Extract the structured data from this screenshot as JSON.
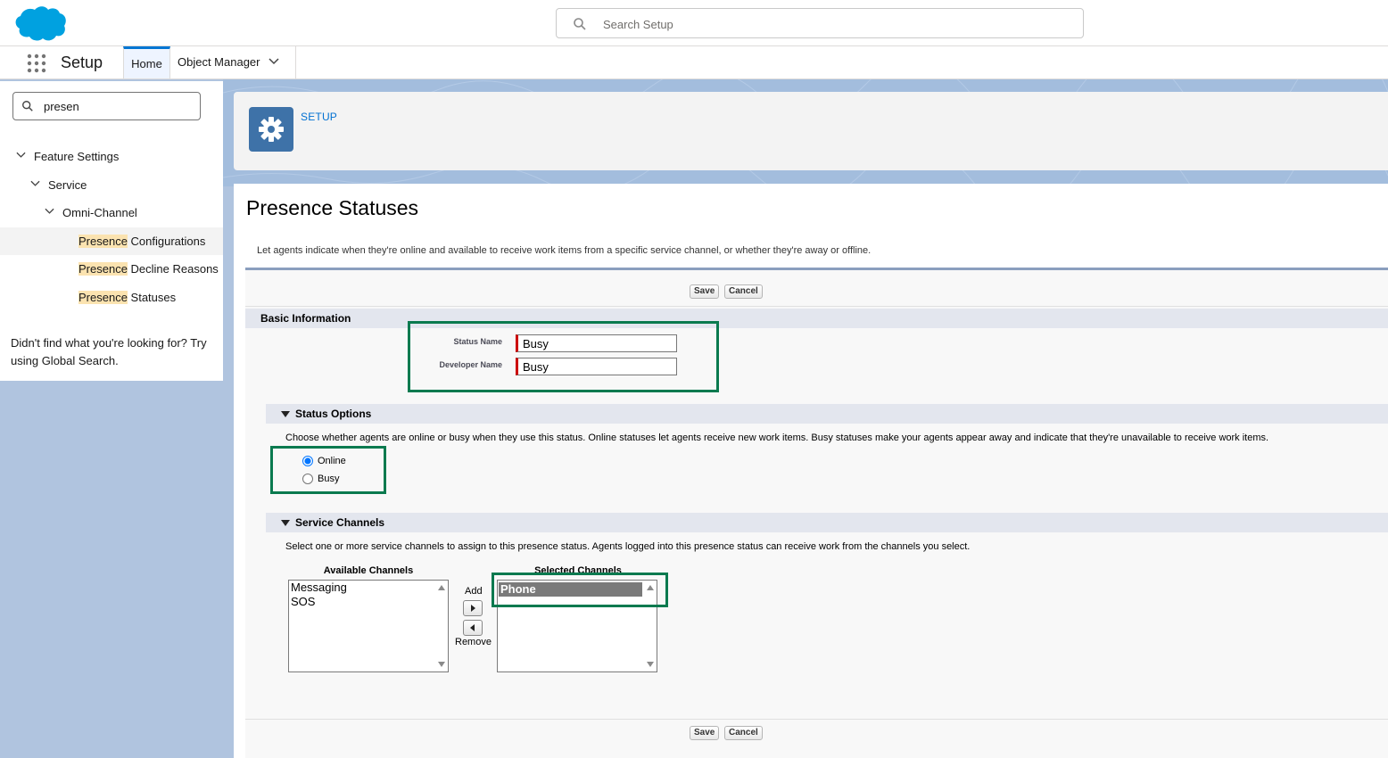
{
  "header": {
    "search_placeholder": "Search Setup",
    "brand_color": "#00a1e0"
  },
  "nav": {
    "app_name": "Setup",
    "tabs": [
      {
        "label": "Home",
        "active": true
      },
      {
        "label": "Object Manager",
        "has_dropdown": true
      }
    ]
  },
  "sidebar": {
    "quickfind_value": "presen",
    "tree": {
      "feature_settings": "Feature Settings",
      "service": "Service",
      "omni_channel": "Omni-Channel",
      "leaves": [
        {
          "match": "Presence",
          "rest": " Configurations",
          "selected": true
        },
        {
          "match": "Presence",
          "rest": " Decline Reasons",
          "selected": false
        },
        {
          "match": "Presence",
          "rest": " Statuses",
          "selected": false
        }
      ]
    },
    "no_match_text": "Didn't find what you're looking for? Try using Global Search."
  },
  "setup_header": {
    "breadcrumb": "SETUP",
    "icon": "gear-icon"
  },
  "page": {
    "title": "Presence Statuses",
    "description": "Let agents indicate when they're online and available to receive work items from a specific service channel, or whether they're away or offline.",
    "save_label": "Save",
    "cancel_label": "Cancel",
    "basic_info": {
      "title": "Basic Information",
      "status_name_label": "Status Name",
      "status_name_value": "Busy",
      "developer_name_label": "Developer Name",
      "developer_name_value": "Busy"
    },
    "status_options": {
      "title": "Status Options",
      "description": "Choose whether agents are online or busy when they use this status. Online statuses let agents receive new work items. Busy statuses make your agents appear away and indicate that they're unavailable to receive work items.",
      "online_label": "Online",
      "busy_label": "Busy",
      "selected": "Online"
    },
    "service_channels": {
      "title": "Service Channels",
      "description": "Select one or more service channels to assign to this presence status. Agents logged into this presence status can receive work from the channels you select.",
      "available_title": "Available Channels",
      "available": [
        "Messaging",
        "SOS"
      ],
      "selected_title": "Selected Channels",
      "selected": [
        "Phone"
      ],
      "add_label": "Add",
      "remove_label": "Remove"
    },
    "highlight_color": "#0a7a4f"
  }
}
